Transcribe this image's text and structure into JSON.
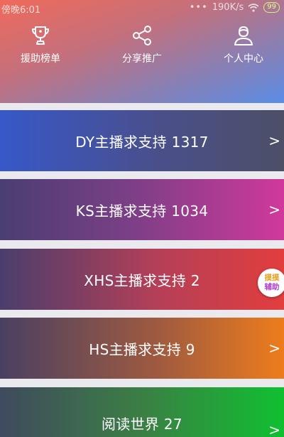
{
  "status_bar": {
    "time": "傍晚6:01",
    "dots": "•••",
    "network_speed": "190K/s",
    "battery": "99"
  },
  "nav": {
    "items": [
      {
        "label": "援助榜单",
        "icon": "trophy-icon"
      },
      {
        "label": "分享推广",
        "icon": "share-icon"
      },
      {
        "label": "个人中心",
        "icon": "user-icon"
      }
    ]
  },
  "cards": [
    {
      "title": "DY主播求支持 1317",
      "arrow": ">"
    },
    {
      "title": "KS主播求支持 1034",
      "arrow": ">"
    },
    {
      "title": "XHS主播求支持 2",
      "arrow": ">"
    },
    {
      "title": "HS主播求支持 9",
      "arrow": ">"
    },
    {
      "title": "阅读世界 27",
      "arrow": ">"
    }
  ],
  "floating_button": {
    "line1": "摸摸",
    "line2": "辅助"
  },
  "colors": {
    "header_start": "#f06a5a",
    "header_end": "#5b8de6",
    "background": "#e9e9ee"
  }
}
